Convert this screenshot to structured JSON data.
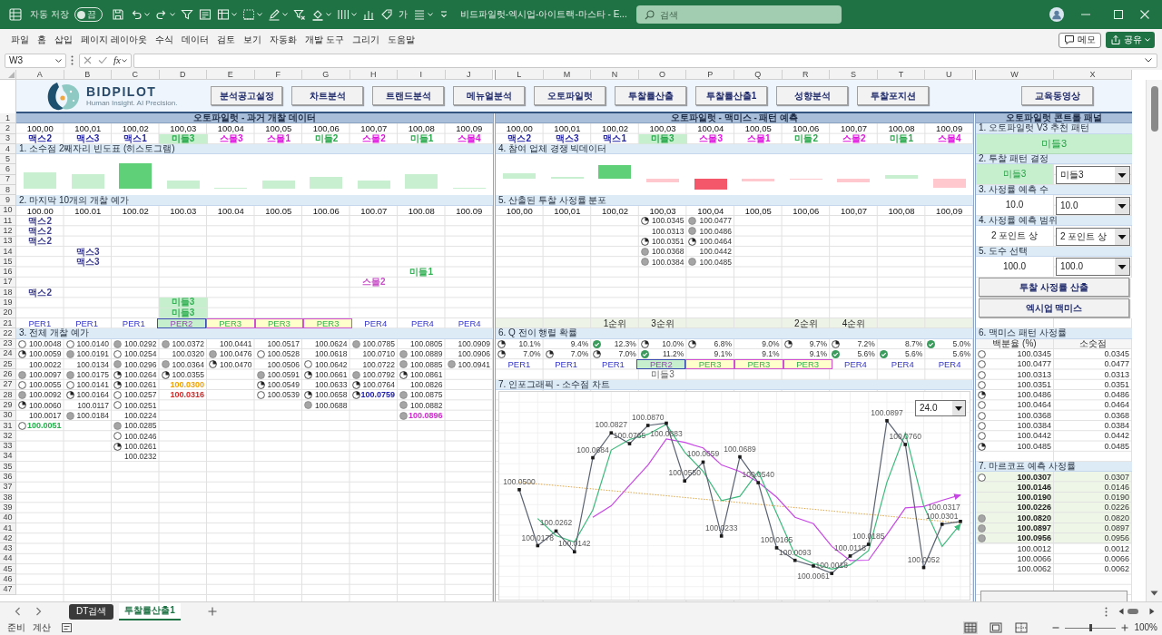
{
  "title_bar": {
    "autosave": {
      "label": "자동 저장",
      "on": false,
      "state": "끔"
    },
    "quick_access_text": "가",
    "title": "비드파일럿-엑시업-아이트랙-마스타 - E...",
    "search": {
      "placeholder": "검색"
    }
  },
  "menu": {
    "items": [
      "파일",
      "홈",
      "삽입",
      "페이지 레이아웃",
      "수식",
      "데이터",
      "검토",
      "보기",
      "자동화",
      "개발 도구",
      "그리기",
      "도움말"
    ],
    "buttons": [
      {
        "label": "메모",
        "kind": "comment"
      },
      {
        "label": "공유",
        "kind": "share"
      }
    ]
  },
  "formula_bar": {
    "name_box": "W3",
    "function_label": "fx"
  },
  "column_headers": {
    "left": [
      "A",
      "B",
      "C",
      "D",
      "E",
      "F",
      "G",
      "H",
      "I",
      "J"
    ],
    "middle": [
      "L",
      "M",
      "N",
      "O",
      "P",
      "Q",
      "R",
      "S",
      "T",
      "U"
    ],
    "right": [
      "W",
      "X"
    ]
  },
  "row_headers": [
    "1",
    "2",
    "3",
    "4",
    "5",
    "6",
    "7",
    "8",
    "9",
    "10",
    "11",
    "12",
    "13",
    "14",
    "15",
    "16",
    "17",
    "18",
    "19",
    "20",
    "21",
    "22",
    "23",
    "24",
    "25",
    "26",
    "27",
    "28",
    "29",
    "30",
    "31",
    "32",
    "33",
    "34",
    "35",
    "36",
    "37",
    "38",
    "39",
    "40",
    "41",
    "42",
    "43",
    "44",
    "45",
    "46",
    "47"
  ],
  "toolbar": {
    "logo": {
      "name": "BIDPILOT",
      "tagline": "Human Insight. AI Precision."
    },
    "buttons": [
      "분석공고설정",
      "차트분석",
      "트랜드분석",
      "메뉴얼분석",
      "오토파일럿",
      "투찰률산출",
      "투찰률산출1",
      "성향분석",
      "투찰포지션"
    ],
    "side_button": "교육동영상"
  },
  "past_data": {
    "title": "오토파일럿 - 과거 개찰 데이터",
    "rates": [
      "100,00",
      "100,01",
      "100,02",
      "100,03",
      "100,04",
      "100,05",
      "100,06",
      "100,07",
      "100,08",
      "100,09"
    ],
    "patterns": [
      {
        "text": "맥스2",
        "color": "#2424a8",
        "highlighted": false
      },
      {
        "text": "맥스3",
        "color": "#2424a8",
        "highlighted": false
      },
      {
        "text": "맥스1",
        "color": "#2424a8",
        "highlighted": false
      },
      {
        "text": "미들3",
        "color": "#27a84a",
        "highlighted": true
      },
      {
        "text": "스몰3",
        "color": "#e014e0",
        "highlighted": false
      },
      {
        "text": "스몰1",
        "color": "#e014e0",
        "highlighted": false
      },
      {
        "text": "미들2",
        "color": "#27a84a",
        "highlighted": false
      },
      {
        "text": "스몰2",
        "color": "#e014e0",
        "highlighted": false
      },
      {
        "text": "미들1",
        "color": "#27a84a",
        "highlighted": false
      },
      {
        "text": "스몰4",
        "color": "#e014e0",
        "highlighted": false
      }
    ],
    "histogram": {
      "title": "1. 소수점 2째자리 빈도표 (히스토그램)"
    },
    "last_ten": {
      "title": "2. 마지막 10개의 개찰 예가",
      "columns": [
        "100.00",
        "100.01",
        "100.02",
        "100.03",
        "100.04",
        "100.05",
        "100.06",
        "100.07",
        "100.08",
        "100.09"
      ],
      "rows": [
        [
          {
            "text": "맥스2",
            "color": "#3b3b8f",
            "highlighted": false
          }
        ],
        [
          {
            "text": "맥스2",
            "color": "#3b3b8f",
            "highlighted": false
          }
        ],
        [
          {
            "text": "맥스2",
            "color": "#3b3b8f",
            "highlighted": false
          }
        ],
        [
          null,
          {
            "text": "맥스3",
            "color": "#3b3b8f",
            "highlighted": false
          }
        ],
        [
          null,
          {
            "text": "맥스3",
            "color": "#3b3b8f",
            "highlighted": false
          }
        ],
        [
          null,
          null,
          null,
          null,
          null,
          null,
          null,
          null,
          {
            "text": "미들1",
            "color": "#35b055",
            "highlighted": false
          }
        ],
        [
          null,
          null,
          null,
          null,
          null,
          null,
          null,
          {
            "text": "스몰2",
            "color": "#c850c8",
            "highlighted": false
          }
        ],
        [
          {
            "text": "맥스2",
            "color": "#3b3b8f",
            "highlighted": false
          }
        ],
        [
          null,
          null,
          null,
          {
            "text": "미들3",
            "color": "#35b055",
            "highlighted": true
          }
        ],
        [
          null,
          null,
          null,
          {
            "text": "미들3",
            "color": "#35b055",
            "highlighted": true
          }
        ]
      ],
      "periods": [
        {
          "text": "PER1",
          "kind": "plain"
        },
        {
          "text": "PER1",
          "kind": "plain"
        },
        {
          "text": "PER1",
          "kind": "plain"
        },
        {
          "text": "PER2",
          "kind": "primary"
        },
        {
          "text": "PER3",
          "kind": "secondary"
        },
        {
          "text": "PER3",
          "kind": "secondary"
        },
        {
          "text": "PER3",
          "kind": "secondary"
        },
        {
          "text": "PER4",
          "kind": "plain"
        },
        {
          "text": "PER4",
          "kind": "plain"
        },
        {
          "text": "PER4",
          "kind": "plain"
        }
      ]
    },
    "all_prices": {
      "title": "3. 전체 개찰 예가",
      "rows": [
        [
          {
            "kind": "empty",
            "text": "100.0048"
          },
          {
            "kind": "empty",
            "text": "100.0140"
          },
          {
            "kind": "full",
            "text": "100.0292"
          },
          {
            "kind": "full",
            "text": "100.0372"
          },
          {
            "kind": "plain",
            "text": "100.0441"
          },
          {
            "kind": "plain",
            "text": "100.0517"
          },
          {
            "kind": "plain",
            "text": "100.0624"
          },
          {
            "kind": "full",
            "text": "100.0785"
          },
          {
            "kind": "plain",
            "text": "100.0805"
          },
          {
            "kind": "plain",
            "text": "100.0909"
          }
        ],
        [
          {
            "kind": "quarter",
            "text": "100.0059"
          },
          {
            "kind": "full",
            "text": "100.0191"
          },
          {
            "kind": "empty",
            "text": "100.0254"
          },
          {
            "kind": "plain",
            "text": "100.0320"
          },
          {
            "kind": "full",
            "text": "100.0476"
          },
          {
            "kind": "empty",
            "text": "100.0528"
          },
          {
            "kind": "plain",
            "text": "100.0618"
          },
          {
            "kind": "plain",
            "text": "100.0710"
          },
          {
            "kind": "full",
            "text": "100.0889"
          },
          {
            "kind": "plain",
            "text": "100.0906"
          }
        ],
        [
          {
            "kind": "plain",
            "text": "100.0022"
          },
          {
            "kind": "plain",
            "text": "100.0134"
          },
          {
            "kind": "full",
            "text": "100.0296"
          },
          {
            "kind": "full",
            "text": "100.0364"
          },
          {
            "kind": "quarter",
            "text": "100.0470"
          },
          {
            "kind": "plain",
            "text": "100.0506"
          },
          {
            "kind": "empty",
            "text": "100.0642"
          },
          {
            "kind": "plain",
            "text": "100.0722"
          },
          {
            "kind": "full",
            "text": "100.0885"
          },
          {
            "kind": "full",
            "text": "100.0941"
          }
        ],
        [
          {
            "kind": "full",
            "text": "100.0097"
          },
          {
            "kind": "full",
            "text": "100.0175"
          },
          {
            "kind": "quarter",
            "text": "100.0264"
          },
          {
            "kind": "quarter",
            "text": "100.0355"
          },
          null,
          {
            "kind": "full",
            "text": "100.0591"
          },
          {
            "kind": "quarter",
            "text": "100.0661"
          },
          {
            "kind": "full",
            "text": "100.0792"
          },
          {
            "kind": "quarter",
            "text": "100.0861"
          }
        ],
        [
          {
            "kind": "empty",
            "text": "100.0055"
          },
          {
            "kind": "empty",
            "text": "100.0141"
          },
          {
            "kind": "quarter",
            "text": "100.0261"
          },
          {
            "kind": "plain",
            "text": "100.0300",
            "color": "#f2a200"
          },
          null,
          {
            "kind": "quarter",
            "text": "100.0549"
          },
          {
            "kind": "plain",
            "text": "100.0633"
          },
          {
            "kind": "quarter",
            "text": "100.0764"
          },
          {
            "kind": "plain",
            "text": "100.0826"
          }
        ],
        [
          {
            "kind": "full",
            "text": "100.0092"
          },
          {
            "kind": "quarter",
            "text": "100.0164"
          },
          {
            "kind": "empty",
            "text": "100.0257"
          },
          {
            "kind": "plain",
            "text": "100.0316",
            "color": "#d42a2a"
          },
          null,
          {
            "kind": "empty",
            "text": "100.0539"
          },
          {
            "kind": "quarter",
            "text": "100.0658"
          },
          {
            "kind": "quarter",
            "text": "100.0759",
            "color": "#2020a8"
          },
          {
            "kind": "full",
            "text": "100.0875"
          }
        ],
        [
          {
            "kind": "quarter",
            "text": "100.0060"
          },
          {
            "kind": "plain",
            "text": "100.0117"
          },
          {
            "kind": "empty",
            "text": "100.0251"
          },
          null,
          null,
          null,
          {
            "kind": "full",
            "text": "100.0688"
          },
          null,
          {
            "kind": "full",
            "text": "100.0882"
          }
        ],
        [
          {
            "kind": "plain",
            "text": "100.0017"
          },
          {
            "kind": "full",
            "text": "100.0184"
          },
          {
            "kind": "plain",
            "text": "100.0224"
          },
          null,
          null,
          null,
          null,
          null,
          {
            "kind": "full",
            "text": "100.0896",
            "color": "#d028d0"
          }
        ],
        [
          {
            "kind": "empty",
            "text": "100.0051",
            "color": "#22b04a"
          },
          null,
          {
            "kind": "full",
            "text": "100.0285"
          }
        ],
        [
          null,
          null,
          {
            "kind": "empty",
            "text": "100.0246"
          }
        ],
        [
          null,
          null,
          {
            "kind": "quarter",
            "text": "100.0261"
          }
        ],
        [
          null,
          null,
          {
            "kind": "plain",
            "text": "100.0232"
          }
        ]
      ]
    }
  },
  "pattern_forecast": {
    "title": "오토파일럿 - 맥미스 - 패턴 예측",
    "rates": [
      "100,00",
      "100,01",
      "100,02",
      "100,03",
      "100,04",
      "100,05",
      "100,06",
      "100,07",
      "100,08",
      "100,09"
    ],
    "patterns": [
      {
        "text": "맥스2",
        "color": "#2424a8",
        "highlighted": false
      },
      {
        "text": "맥스3",
        "color": "#2424a8",
        "highlighted": false
      },
      {
        "text": "맥스1",
        "color": "#2424a8",
        "highlighted": false
      },
      {
        "text": "미들3",
        "color": "#27a84a",
        "highlighted": true
      },
      {
        "text": "스몰3",
        "color": "#e014e0",
        "highlighted": false
      },
      {
        "text": "스몰1",
        "color": "#e014e0",
        "highlighted": false
      },
      {
        "text": "미들2",
        "color": "#27a84a",
        "highlighted": false
      },
      {
        "text": "스몰2",
        "color": "#e014e0",
        "highlighted": false
      },
      {
        "text": "미들1",
        "color": "#27a84a",
        "highlighted": false
      },
      {
        "text": "스몰4",
        "color": "#e014e0",
        "highlighted": false
      }
    ],
    "competition": {
      "title": "4. 참여 업체 경쟁 빅데이터"
    },
    "distribution": {
      "title": "5. 산출된 투찰 사정률 분포",
      "columns": [
        {
          "label": "100,00"
        },
        {
          "label": "100,01"
        },
        {
          "label": "100,02",
          "rank": "1순위"
        },
        {
          "label": "100,03",
          "rank": "3순위"
        },
        {
          "label": "100,04"
        },
        {
          "label": "100,05"
        },
        {
          "label": "100,06",
          "rank": "2순위"
        },
        {
          "label": "100,07",
          "rank": "4순위"
        },
        {
          "label": "100,08"
        },
        {
          "label": "100,09"
        }
      ],
      "rows": [
        [
          null,
          null,
          null,
          {
            "kind": "quarter",
            "text": "100.0345"
          },
          {
            "kind": "full",
            "text": "100.0477"
          }
        ],
        [
          null,
          null,
          null,
          {
            "kind": "plain",
            "text": "100.0313"
          },
          {
            "kind": "full",
            "text": "100.0486"
          }
        ],
        [
          null,
          null,
          null,
          {
            "kind": "quarter",
            "text": "100.0351"
          },
          {
            "kind": "quarter",
            "text": "100.0464"
          }
        ],
        [
          null,
          null,
          null,
          {
            "kind": "full",
            "text": "100.0368"
          },
          {
            "kind": "plain",
            "text": "100.0442"
          }
        ],
        [
          null,
          null,
          null,
          {
            "kind": "full",
            "text": "100.0384"
          },
          {
            "kind": "full",
            "text": "100.0485"
          }
        ]
      ]
    },
    "transition": {
      "title": "6. Q 전이 행렬 확률",
      "rows": [
        [
          {
            "kind": "quarter",
            "text": "10.1%"
          },
          {
            "kind": "plain",
            "text": "9.4%"
          },
          {
            "kind": "check",
            "text": "12.3%"
          },
          {
            "kind": "quarter",
            "text": "10.0%"
          },
          {
            "kind": "quarter",
            "text": "6.8%"
          },
          {
            "kind": "plain",
            "text": "9.0%"
          },
          {
            "kind": "quarter",
            "text": "9.7%"
          },
          {
            "kind": "quarter",
            "text": "7.2%"
          },
          {
            "kind": "plain",
            "text": "8.7%"
          },
          {
            "kind": "check",
            "text": "5.0%"
          }
        ],
        [
          {
            "kind": "quarter",
            "text": "7.0%"
          },
          {
            "kind": "quarter",
            "text": "7.0%"
          },
          {
            "kind": "quarter",
            "text": "7.0%"
          },
          {
            "kind": "check",
            "text": "11.2%"
          },
          {
            "kind": "plain",
            "text": "9.1%"
          },
          {
            "kind": "plain",
            "text": "9.1%"
          },
          {
            "kind": "plain",
            "text": "9.1%"
          },
          {
            "kind": "check",
            "text": "5.6%"
          },
          {
            "kind": "check",
            "text": "5.6%"
          },
          {
            "kind": "plain",
            "text": "5.6%"
          }
        ]
      ],
      "periods": [
        {
          "text": "PER1",
          "kind": "plain"
        },
        {
          "text": "PER1",
          "kind": "plain"
        },
        {
          "text": "PER1",
          "kind": "plain"
        },
        {
          "text": "PER2",
          "kind": "primary",
          "note": "미들3"
        },
        {
          "text": "PER3",
          "kind": "secondary"
        },
        {
          "text": "PER3",
          "kind": "secondary"
        },
        {
          "text": "PER3",
          "kind": "secondary"
        },
        {
          "text": "PER4",
          "kind": "plain"
        },
        {
          "text": "PER4",
          "kind": "plain"
        },
        {
          "text": "PER4",
          "kind": "plain"
        }
      ]
    },
    "chart": {
      "title": "7. 인포그래픽 - 소수점 차트",
      "dropdown": "24.0",
      "arrowheads": [
        false,
        true,
        true,
        false
      ],
      "chart_data": {
        "type": "line",
        "grid": true,
        "ylim": [
          99.9867,
          100.1063
        ],
        "series": [
          {
            "color": "#5b6272",
            "marker": "square",
            "values": [
              100.05,
              100.0178,
              100.0262,
              100.0142,
              100.0684,
              100.0827,
              100.0765,
              100.087,
              100.0883,
              100.055,
              100.0659,
              100.0233,
              100.0689,
              100.054,
              100.0165,
              100.0093,
              100.0061,
              100.0018,
              100.0118,
              100.0185,
              100.0897,
              100.076,
              100.0052,
              100.0301,
              100.0317
            ],
            "value_labels": [
              "100.0500",
              "100.0178",
              "100.0262",
              "100.0142",
              "100.0684",
              "100.0827",
              "100.0765",
              "100.0870",
              "100.0883",
              "100.0550",
              "100.0659",
              "100.0233",
              "100.0689",
              "100.0540",
              "100.0165",
              "100.0093",
              "100.0061",
              "100.0018",
              "100.0118",
              "100.0185",
              "100.0897",
              "100.0760",
              "100.0052",
              "100.0301",
              "100.0317"
            ]
          },
          {
            "color": "#3dba7c",
            "values": [
              null,
              100.0334,
              100.0235,
              100.0198,
              100.0383,
              100.0728,
              100.0789,
              100.0819,
              100.0876,
              100.0715,
              100.0605,
              100.0437,
              100.0462,
              100.0605,
              100.0363,
              100.0124,
              100.0075,
              100.0043,
              100.0067,
              100.0149,
              100.0543,
              100.0826,
              100.0407,
              100.0173,
              100.0302
            ]
          },
          {
            "color": "#c847e6",
            "values": [
              null,
              null,
              null,
              null,
              100.0341,
              100.0407,
              100.0526,
              100.0642,
              100.0792,
              100.0772,
              100.074,
              100.0642,
              100.0605,
              100.0543,
              100.0457,
              100.0341,
              100.0304,
              100.0173,
              100.0092,
              100.0094,
              100.0242,
              100.0395,
              100.0403,
              100.0439,
              100.0469
            ]
          },
          {
            "color": "#e0a84a",
            "line_style": "dotted",
            "values": [
              100.0543,
              100.0533,
              100.0524,
              100.0514,
              100.0504,
              100.0494,
              100.0485,
              100.0475,
              100.0465,
              100.0455,
              100.0445,
              100.0436,
              100.0426,
              100.0416,
              100.0406,
              100.0397,
              100.0387,
              100.0377,
              100.0367,
              100.0358,
              100.0348,
              100.0338,
              100.0328,
              100.0319,
              100.0309
            ]
          }
        ]
      }
    }
  },
  "control_panel": {
    "title": "오토파일럿 콘트롤 패널",
    "recommendation": {
      "title": "1. 오토파일럿 V3 추천 패턴",
      "value": "미들3"
    },
    "settings": [
      {
        "title": "2. 투찰 패턴 결정",
        "value": "미들3",
        "highlighted": true,
        "choice": "미들3"
      },
      {
        "title": "3. 사정률 예측 수",
        "value": "10.0",
        "highlighted": false,
        "choice": "10.0"
      },
      {
        "title": "4. 사정률 예측 범위",
        "value": "2 포인트 상",
        "highlighted": false,
        "choice": "2 포인트 상"
      },
      {
        "title": "5. 도수 선택",
        "value": "100.0",
        "highlighted": false,
        "choice": "100.0"
      }
    ],
    "buttons": [
      "투찰 사정률 산출",
      "엑시업 맥미스"
    ],
    "maxmiss": {
      "title": "6. 맥미스 패턴 사정률",
      "headers": [
        "백분율 (%)",
        "소숫점"
      ],
      "rows": [
        {
          "kind": "empty",
          "percent": "100.0345",
          "decimal": "0.0345"
        },
        {
          "kind": "empty",
          "percent": "100.0477",
          "decimal": "0.0477"
        },
        {
          "kind": "empty",
          "percent": "100.0313",
          "decimal": "0.0313"
        },
        {
          "kind": "empty",
          "percent": "100.0351",
          "decimal": "0.0351"
        },
        {
          "kind": "quarter",
          "percent": "100.0486",
          "decimal": "0.0486"
        },
        {
          "kind": "empty",
          "percent": "100.0464",
          "decimal": "0.0464"
        },
        {
          "kind": "empty",
          "percent": "100.0368",
          "decimal": "0.0368"
        },
        {
          "kind": "empty",
          "percent": "100.0384",
          "decimal": "0.0384"
        },
        {
          "kind": "empty",
          "percent": "100.0442",
          "decimal": "0.0442"
        },
        {
          "kind": "quarter",
          "percent": "100.0485",
          "decimal": "0.0485"
        }
      ]
    },
    "markov": {
      "title": "7. 마르코프 예측 사정률",
      "rows": [
        {
          "kind": "empty",
          "percent": "100.0307",
          "decimal": "0.0307",
          "highlighted": true
        },
        {
          "kind": "plain",
          "percent": "100.0146",
          "decimal": "0.0146",
          "highlighted": true
        },
        {
          "kind": "plain",
          "percent": "100.0190",
          "decimal": "0.0190",
          "highlighted": true
        },
        {
          "kind": "plain",
          "percent": "100.0226",
          "decimal": "0.0226",
          "highlighted": true
        },
        {
          "kind": "full",
          "percent": "100.0820",
          "decimal": "0.0820",
          "highlighted": true
        },
        {
          "kind": "full",
          "percent": "100.0897",
          "decimal": "0.0897",
          "highlighted": true
        },
        {
          "kind": "full",
          "percent": "100.0956",
          "decimal": "0.0956",
          "highlighted": true
        },
        {
          "kind": "plain",
          "percent": "100.0012",
          "decimal": "0.0012",
          "highlighted": false
        },
        {
          "kind": "plain",
          "percent": "100.0066",
          "decimal": "0.0066",
          "highlighted": false
        },
        {
          "kind": "plain",
          "percent": "100.0062",
          "decimal": "0.0062",
          "highlighted": false
        }
      ]
    }
  },
  "sheet_tabs": [
    {
      "label": "DT검색",
      "selected": false,
      "color": "#3a3a3a"
    },
    {
      "label": "투찰률산출1",
      "selected": true
    }
  ],
  "status_bar": {
    "items": [
      "준비",
      "계산"
    ],
    "views": [
      {
        "kind": "normal",
        "selected": true
      },
      {
        "kind": "page_layout",
        "selected": false
      },
      {
        "kind": "page_break",
        "selected": false
      }
    ],
    "zoom": {
      "level": 0.5,
      "label": "100%"
    }
  }
}
